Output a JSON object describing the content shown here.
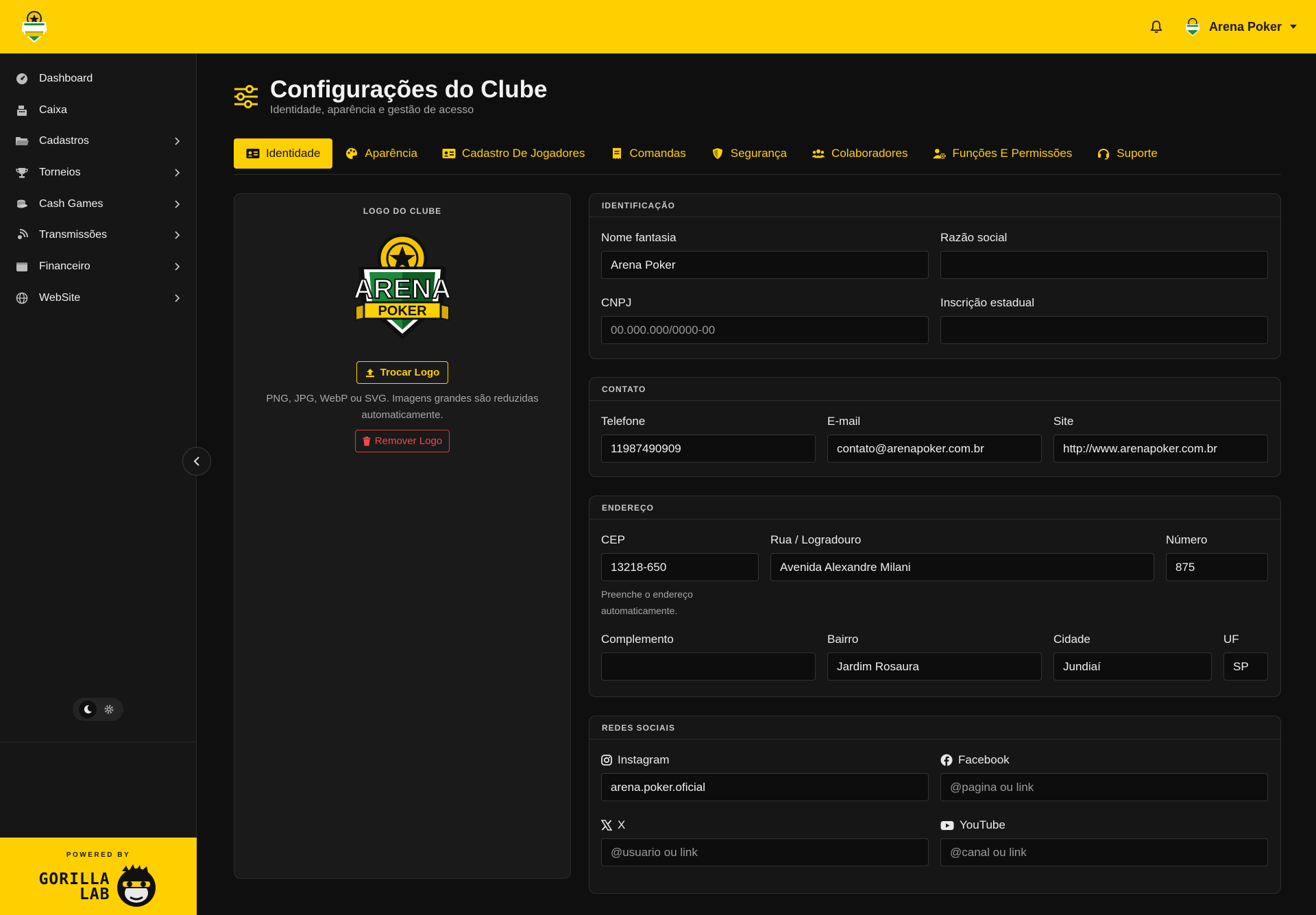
{
  "topbar": {
    "user_name": "Arena Poker"
  },
  "sidebar": {
    "items": [
      {
        "label": "Dashboard",
        "icon": "gauge-icon",
        "has_children": false
      },
      {
        "label": "Caixa",
        "icon": "cash-register-icon",
        "has_children": false
      },
      {
        "label": "Cadastros",
        "icon": "folder-icon",
        "has_children": true
      },
      {
        "label": "Torneios",
        "icon": "trophy-icon",
        "has_children": true
      },
      {
        "label": "Cash Games",
        "icon": "coins-icon",
        "has_children": true
      },
      {
        "label": "Transmissões",
        "icon": "broadcast-icon",
        "has_children": true
      },
      {
        "label": "Financeiro",
        "icon": "wallet-icon",
        "has_children": true
      },
      {
        "label": "WebSite",
        "icon": "globe-icon",
        "has_children": true
      }
    ],
    "powered_by": "POWERED BY",
    "brand_line1": "GORILLA",
    "brand_line2": "LAB"
  },
  "page": {
    "title": "Configurações do Clube",
    "subtitle": "Identidade, aparência e gestão de acesso"
  },
  "tabs": [
    {
      "label": "Identidade",
      "icon": "id-card-icon",
      "active": true
    },
    {
      "label": "Aparência",
      "icon": "palette-icon",
      "active": false
    },
    {
      "label": "Cadastro De Jogadores",
      "icon": "address-card-icon",
      "active": false
    },
    {
      "label": "Comandas",
      "icon": "receipt-icon",
      "active": false
    },
    {
      "label": "Segurança",
      "icon": "shield-icon",
      "active": false
    },
    {
      "label": "Colaboradores",
      "icon": "users-icon",
      "active": false
    },
    {
      "label": "Funções E Permissões",
      "icon": "user-gear-icon",
      "active": false
    },
    {
      "label": "Suporte",
      "icon": "headset-icon",
      "active": false
    }
  ],
  "logo_card": {
    "title": "LOGO DO CLUBE",
    "swap_label": "Trocar Logo",
    "hint": "PNG, JPG, WebP ou SVG. Imagens grandes são reduzidas automaticamente.",
    "remove_label": "Remover Logo",
    "logo_text_top": "ARENA",
    "logo_text_bottom": "POKER"
  },
  "identificacao": {
    "title": "IDENTIFICAÇÃO",
    "nome_fantasia": {
      "label": "Nome fantasia",
      "value": "Arena Poker",
      "placeholder": ""
    },
    "razao_social": {
      "label": "Razão social",
      "value": "",
      "placeholder": ""
    },
    "cnpj": {
      "label": "CNPJ",
      "value": "",
      "placeholder": "00.000.000/0000-00"
    },
    "inscricao_estadual": {
      "label": "Inscrição estadual",
      "value": "",
      "placeholder": ""
    }
  },
  "contato": {
    "title": "CONTATO",
    "telefone": {
      "label": "Telefone",
      "value": "11987490909"
    },
    "email": {
      "label": "E-mail",
      "value": "contato@arenapoker.com.br"
    },
    "site": {
      "label": "Site",
      "value": "http://www.arenapoker.com.br"
    }
  },
  "endereco": {
    "title": "ENDEREÇO",
    "cep": {
      "label": "CEP",
      "value": "13218-650",
      "help": "Preenche o endereço automaticamente."
    },
    "rua": {
      "label": "Rua / Logradouro",
      "value": "Avenida Alexandre Milani"
    },
    "numero": {
      "label": "Número",
      "value": "875"
    },
    "complemento": {
      "label": "Complemento",
      "value": ""
    },
    "bairro": {
      "label": "Bairro",
      "value": "Jardim Rosaura"
    },
    "cidade": {
      "label": "Cidade",
      "value": "Jundiaí"
    },
    "uf": {
      "label": "UF",
      "value": "SP"
    }
  },
  "redes_sociais": {
    "title": "REDES SOCIAIS",
    "instagram": {
      "label": "Instagram",
      "value": "arena.poker.oficial",
      "placeholder": ""
    },
    "facebook": {
      "label": "Facebook",
      "value": "",
      "placeholder": "@pagina ou link"
    },
    "x": {
      "label": "X",
      "value": "",
      "placeholder": "@usuario ou link"
    },
    "youtube": {
      "label": "YouTube",
      "value": "",
      "placeholder": "@canal ou link"
    }
  },
  "colors": {
    "accent": "#ffd000",
    "danger": "#e0393b",
    "background": "#0f0f0f",
    "sidebar": "#161616"
  }
}
